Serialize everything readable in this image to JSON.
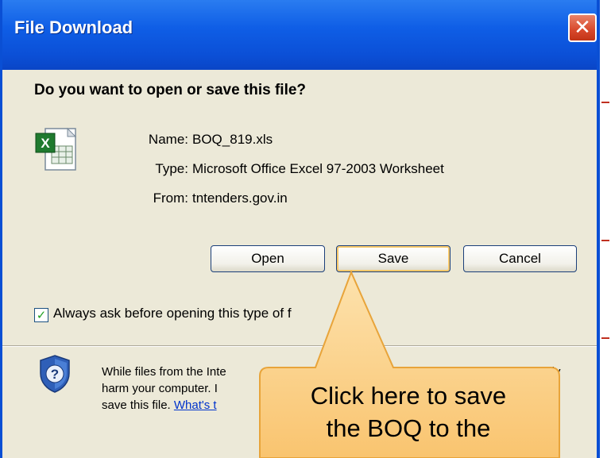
{
  "dialog": {
    "title": "File Download",
    "question": "Do you want to open or save this file?",
    "file": {
      "name_label": "Name:",
      "name_value": "BOQ_819.xls",
      "type_label": "Type:",
      "type_value": "Microsoft Office Excel 97-2003 Worksheet",
      "from_label": "From:",
      "from_value": "tntenders.gov.in"
    },
    "buttons": {
      "open": "Open",
      "save": "Save",
      "cancel": "Cancel"
    },
    "checkbox": {
      "label": "Always ask before opening this type of f",
      "checked": true
    },
    "warning": {
      "line1_a": "While files from the Inte",
      "line1_b": "ally",
      "line2": "harm your computer. I",
      "line3": "save this file. ",
      "link": "What's t"
    }
  },
  "callout": {
    "line1": "Click here to save",
    "line2": "the BOQ to the"
  },
  "colors": {
    "titlebar": "#0b4fd6",
    "dialog_bg": "#ece9d8",
    "callout_fill": "#fcd38c",
    "link": "#0033cc"
  },
  "icons": {
    "file": "excel-file-icon",
    "shield": "security-shield-icon",
    "close": "close-icon"
  }
}
